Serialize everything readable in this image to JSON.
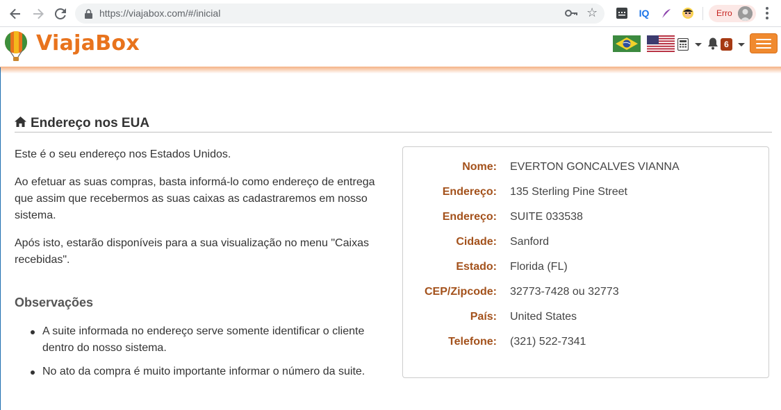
{
  "browser": {
    "url": "https://viajabox.com/#/inicial",
    "iq_ext": "IQ",
    "profile_label": "Erro"
  },
  "header": {
    "brand": "ViajaBox",
    "notification_count": "6"
  },
  "section": {
    "title": "Endereço nos EUA",
    "paragraphs": [
      "Este é o seu endereço nos Estados Unidos.",
      "Ao efetuar as suas compras, basta informá-lo como endereço de entrega que assim que recebermos as suas caixas as cadastraremos em nosso sistema.",
      "Após isto, estarão disponíveis para a sua visualização no menu \"Caixas recebidas\"."
    ],
    "observations_title": "Observações",
    "observations": [
      "A suite informada no endereço serve somente identificar o cliente dentro do nosso sistema.",
      "No ato da compra é muito importante informar o número da suite."
    ]
  },
  "address": {
    "rows": [
      {
        "label": "Nome:",
        "value": "EVERTON GONCALVES VIANNA"
      },
      {
        "label": "Endereço:",
        "value": "135 Sterling Pine Street"
      },
      {
        "label": "Endereço:",
        "value": "SUITE 033538"
      },
      {
        "label": "Cidade:",
        "value": "Sanford"
      },
      {
        "label": "Estado:",
        "value": "Florida (FL)"
      },
      {
        "label": "CEP/Zipcode:",
        "value": "32773-7428 ou 32773"
      },
      {
        "label": "País:",
        "value": "United States"
      },
      {
        "label": "Telefone:",
        "value": "(321) 522-7341"
      }
    ]
  },
  "colors": {
    "brand_orange": "#e8731d",
    "label_brown": "#a3511b",
    "menu_button": "#f08a2f",
    "badge": "#a63a13"
  },
  "icons": [
    "back-icon",
    "forward-icon",
    "reload-icon",
    "lock-icon",
    "key-icon",
    "star-icon",
    "balloon-logo",
    "brazil-flag-icon",
    "us-flag-icon",
    "calculator-icon",
    "bell-icon",
    "hamburger-icon",
    "home-icon"
  ]
}
